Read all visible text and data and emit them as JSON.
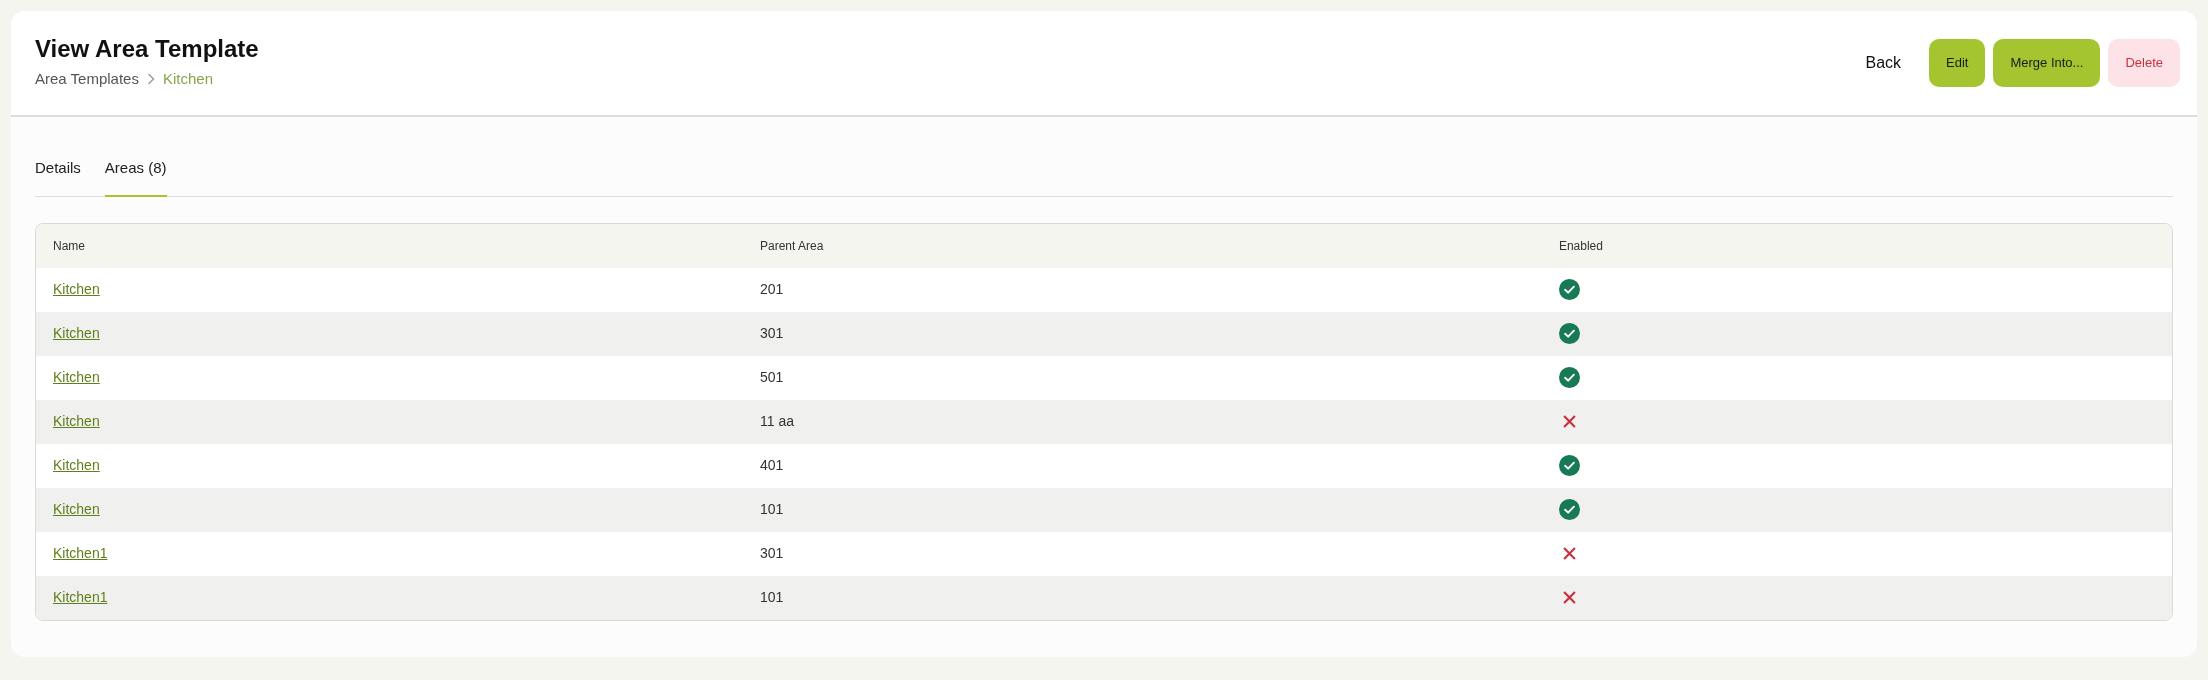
{
  "page": {
    "title": "View Area Template",
    "breadcrumb": [
      {
        "label": "Area Templates",
        "current": false
      },
      {
        "label": "Kitchen",
        "current": true
      }
    ]
  },
  "actions": [
    {
      "label": "Back",
      "kind": "plain"
    },
    {
      "label": "Edit",
      "kind": "primary"
    },
    {
      "label": "Merge Into...",
      "kind": "primary"
    },
    {
      "label": "Delete",
      "kind": "danger"
    }
  ],
  "tabs": [
    {
      "label": "Details",
      "selected": false
    },
    {
      "label": "Areas (8)",
      "selected": true
    }
  ],
  "table": {
    "columns": [
      "Name",
      "Parent Area",
      "Enabled"
    ],
    "rows": [
      {
        "name": "Kitchen",
        "parent_area": "201",
        "enabled": true
      },
      {
        "name": "Kitchen",
        "parent_area": "301",
        "enabled": true
      },
      {
        "name": "Kitchen",
        "parent_area": "501",
        "enabled": true
      },
      {
        "name": "Kitchen",
        "parent_area": "11 aa",
        "enabled": false
      },
      {
        "name": "Kitchen",
        "parent_area": "401",
        "enabled": true
      },
      {
        "name": "Kitchen",
        "parent_area": "101",
        "enabled": true
      },
      {
        "name": "Kitchen1",
        "parent_area": "301",
        "enabled": false
      },
      {
        "name": "Kitchen1",
        "parent_area": "101",
        "enabled": false
      }
    ]
  }
}
